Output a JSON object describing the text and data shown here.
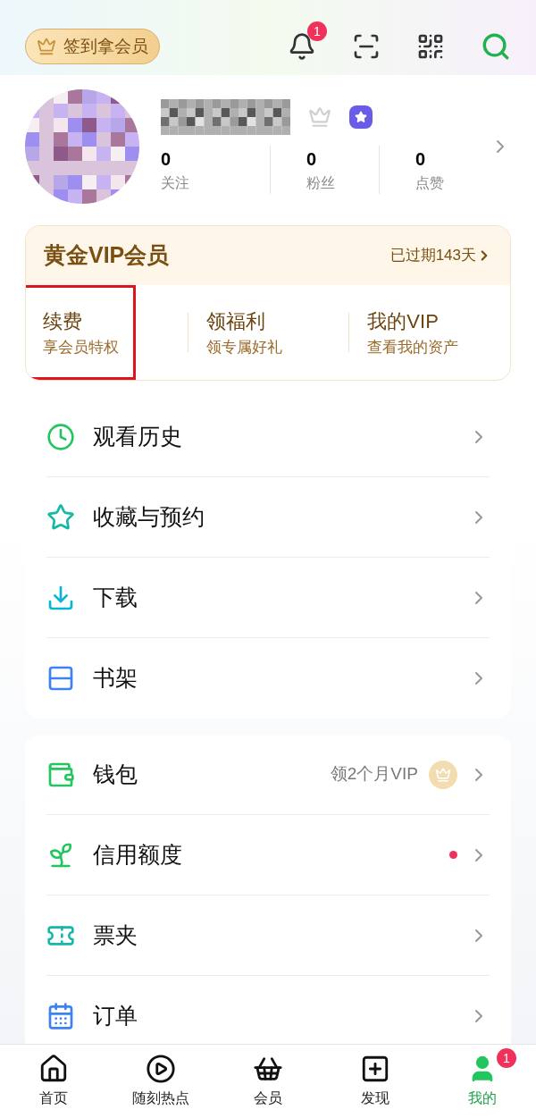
{
  "checkin_button": "签到拿会员",
  "notifications": {
    "badge": "1"
  },
  "profile": {
    "stats": [
      {
        "value": "0",
        "label": "关注"
      },
      {
        "value": "0",
        "label": "粉丝"
      },
      {
        "value": "0",
        "label": "点赞"
      }
    ]
  },
  "vip_card": {
    "title": "黄金VIP会员",
    "status": "已过期143天",
    "actions": [
      {
        "title": "续费",
        "subtitle": "享会员特权",
        "highlighted": true
      },
      {
        "title": "领福利",
        "subtitle": "领专属好礼",
        "highlighted": false
      },
      {
        "title": "我的VIP",
        "subtitle": "查看我的资产",
        "highlighted": false
      }
    ]
  },
  "menu_groups": [
    {
      "items": [
        {
          "label": "观看历史",
          "dot": false
        },
        {
          "label": "收藏与预约",
          "dot": false
        },
        {
          "label": "下载",
          "dot": false
        },
        {
          "label": "书架",
          "dot": false
        }
      ]
    },
    {
      "items": [
        {
          "label": "钱包",
          "note": "领2个月VIP",
          "dot": false
        },
        {
          "label": "信用额度",
          "dot": true
        },
        {
          "label": "票夹",
          "dot": false
        },
        {
          "label": "订单",
          "dot": false
        }
      ]
    }
  ],
  "tab_bar": [
    {
      "label": "首页",
      "selected": false
    },
    {
      "label": "随刻热点",
      "selected": false
    },
    {
      "label": "会员",
      "selected": false
    },
    {
      "label": "发现",
      "selected": false
    },
    {
      "label": "我的",
      "selected": true,
      "badge": "1"
    }
  ]
}
